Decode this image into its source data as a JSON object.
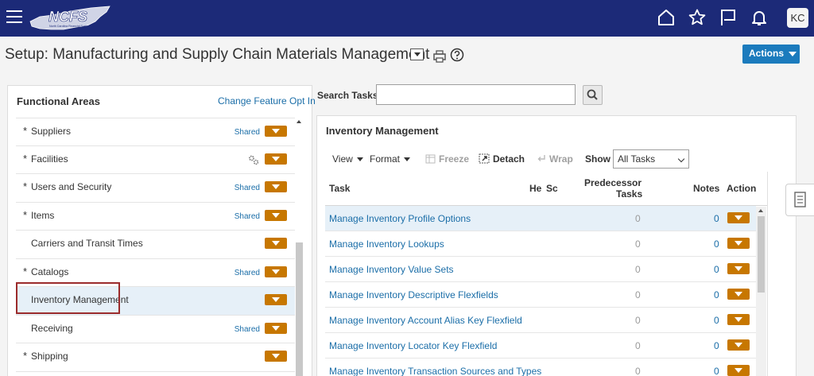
{
  "app": {
    "logo_text": "NCFS",
    "logo_tagline": "North Carolina Financial System",
    "user_initials": "KC"
  },
  "header": {
    "title": "Setup: Manufacturing and Supply Chain Materials Management",
    "actions_label": "Actions"
  },
  "functional_areas": {
    "title": "Functional Areas",
    "change_link": "Change Feature Opt In",
    "items": [
      {
        "label": "Suppliers",
        "required": "*",
        "status": "Shared"
      },
      {
        "label": "Facilities",
        "required": "*",
        "status": ""
      },
      {
        "label": "Users and Security",
        "required": "*",
        "status": "Shared"
      },
      {
        "label": "Items",
        "required": "*",
        "status": "Shared"
      },
      {
        "label": "Carriers and Transit Times",
        "required": "",
        "status": ""
      },
      {
        "label": "Catalogs",
        "required": "*",
        "status": "Shared"
      },
      {
        "label": "Inventory Management",
        "required": "",
        "status": ""
      },
      {
        "label": "Receiving",
        "required": "",
        "status": "Shared"
      },
      {
        "label": "Shipping",
        "required": "*",
        "status": ""
      }
    ]
  },
  "search": {
    "label": "Search Tasks",
    "value": "",
    "placeholder": ""
  },
  "tasks_panel": {
    "title": "Inventory Management",
    "toolbar": {
      "view": "View",
      "format": "Format",
      "freeze": "Freeze",
      "detach": "Detach",
      "wrap": "Wrap",
      "show_label": "Show",
      "show_value": "All Tasks"
    },
    "columns": {
      "task": "Task",
      "he": "He",
      "sc": "Sc",
      "predecessor": "Predecessor",
      "predecessor_line2": "Tasks",
      "notes": "Notes",
      "action": "Action"
    },
    "rows": [
      {
        "task": "Manage Inventory Profile Options",
        "predecessor": "0",
        "notes": "0"
      },
      {
        "task": "Manage Inventory Lookups",
        "predecessor": "0",
        "notes": "0"
      },
      {
        "task": "Manage Inventory Value Sets",
        "predecessor": "0",
        "notes": "0"
      },
      {
        "task": "Manage Inventory Descriptive Flexfields",
        "predecessor": "0",
        "notes": "0"
      },
      {
        "task": "Manage Inventory Account Alias Key Flexfield",
        "predecessor": "0",
        "notes": "0"
      },
      {
        "task": "Manage Inventory Locator Key Flexfield",
        "predecessor": "0",
        "notes": "0"
      },
      {
        "task": "Manage Inventory Transaction Sources and Types",
        "predecessor": "0",
        "notes": "0"
      }
    ]
  },
  "colors": {
    "topbar": "#1c2a78",
    "accent_blue": "#1b7bbd",
    "link": "#1b6ea8",
    "action_orange": "#c77700",
    "highlight_box": "#9b2b2b",
    "selected_row": "#e6f0f8"
  }
}
